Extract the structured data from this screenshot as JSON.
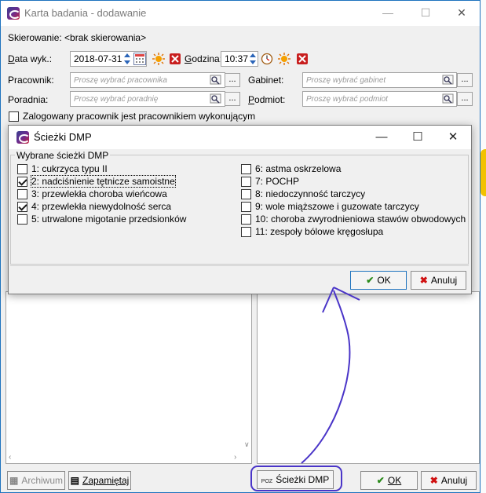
{
  "main_window": {
    "title": "Karta badania - dodawanie",
    "referral_label": "Skierowanie: <brak skierowania>",
    "date_label": "Data wyk.:",
    "date_value": "2018-07-31",
    "hour_label": "Godzina:",
    "hour_value": "10:37",
    "employee_label": "Pracownik:",
    "employee_placeholder": "Proszę wybrać pracownika",
    "office_label": "Gabinet:",
    "office_placeholder": "Proszę wybrać gabinet",
    "clinic_label": "Poradnia:",
    "clinic_placeholder": "Proszę wybrać poradnię",
    "entity_label": "Podmiot:",
    "entity_placeholder": "Proszę wybrać podmiot",
    "logged_worker_checkbox_label": "Zalogowany pracownik jest pracownikiem wykonującym",
    "ellipsis_button": "...",
    "archive_button": "Archiwum",
    "remember_button": "Zapamiętaj",
    "dmp_button_badge": "POZ",
    "dmp_button": "Ścieżki DMP",
    "ok_button": "OK",
    "cancel_button": "Anuluj"
  },
  "dialog": {
    "title": "Ścieżki DMP",
    "group_label": "Wybrane ścieżki DMP",
    "ok_button": "OK",
    "cancel_button": "Anuluj",
    "items_left": [
      {
        "label": "1: cukrzyca typu II",
        "checked": false
      },
      {
        "label": "2: nadciśnienie tętnicze samoistne",
        "checked": true
      },
      {
        "label": "3: przewlekła choroba wieńcowa",
        "checked": false
      },
      {
        "label": "4: przewlekła niewydolność serca",
        "checked": true
      },
      {
        "label": "5: utrwalone migotanie przedsionków",
        "checked": false
      }
    ],
    "items_right": [
      {
        "label": "6: astma oskrzelowa",
        "checked": false
      },
      {
        "label": "7: POCHP",
        "checked": false
      },
      {
        "label": "8: niedoczynność tarczycy",
        "checked": false
      },
      {
        "label": "9: wole miąższowe i guzowate tarczycy",
        "checked": false
      },
      {
        "label": "10: choroba zwyrodnieniowa stawów obwodowych",
        "checked": false
      },
      {
        "label": "11: zespoły bólowe kręgosłupa",
        "checked": false
      }
    ]
  },
  "colors": {
    "window_border": "#1e73be",
    "annotation": "#4a35c8"
  }
}
